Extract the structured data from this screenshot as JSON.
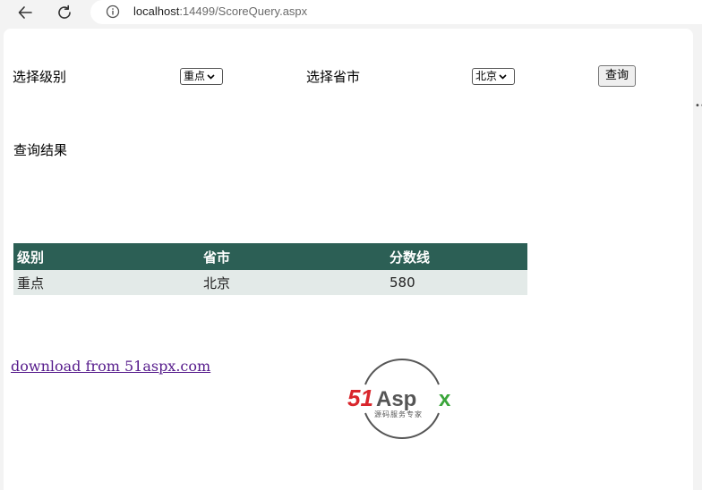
{
  "browser": {
    "url_host": "localhost",
    "url_path": ":14499/ScoreQuery.aspx"
  },
  "form": {
    "level_label": "选择级别",
    "level_value": "重点",
    "province_label": "选择省市",
    "province_value": "北京",
    "query_button": "查询"
  },
  "result_label": "查询结果",
  "table": {
    "headers": [
      "级别",
      "省市",
      "分数线"
    ],
    "rows": [
      [
        "重点",
        "北京",
        "580"
      ]
    ]
  },
  "footer": {
    "download_link": "download from 51aspx.com",
    "logo_main": "51Aspx",
    "logo_sub": "源码服务专家"
  },
  "colors": {
    "header_bg": "#2c5f55",
    "row_bg": "#e3eae8",
    "link": "#551a8b",
    "logo_red": "#d9262c",
    "logo_green": "#3aa53a"
  }
}
